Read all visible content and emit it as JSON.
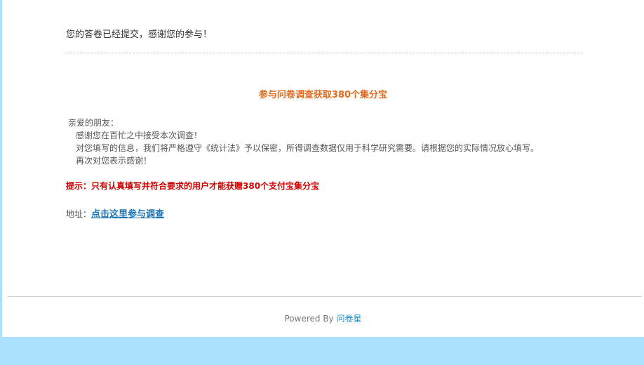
{
  "completion": {
    "message": "您的答卷已经提交，感谢您的参与！"
  },
  "promo": {
    "title": "参与问卷调查获取380个集分宝"
  },
  "letter": {
    "greeting": "亲爱的朋友：",
    "lines": [
      "感谢您在百忙之中接受本次调查！",
      "对您填写的信息，我们将严格遵守《统计法》予以保密，所得调查数据仅用于科学研究需要。请根据您的实际情况放心填写。",
      "再次对您表示感谢！"
    ]
  },
  "tip": {
    "text": "提示：只有认真填写并符合要求的用户才能获赠380个支付宝集分宝"
  },
  "address": {
    "label": "地址：",
    "link_text": "点击这里参与调查"
  },
  "footer": {
    "powered_by": "Powered By ",
    "brand_link": "问卷星"
  },
  "colors": {
    "page_background": "#abe0ff",
    "promo_title": "#e06b1f",
    "tip": "#d40000",
    "link": "#1a73b5"
  }
}
